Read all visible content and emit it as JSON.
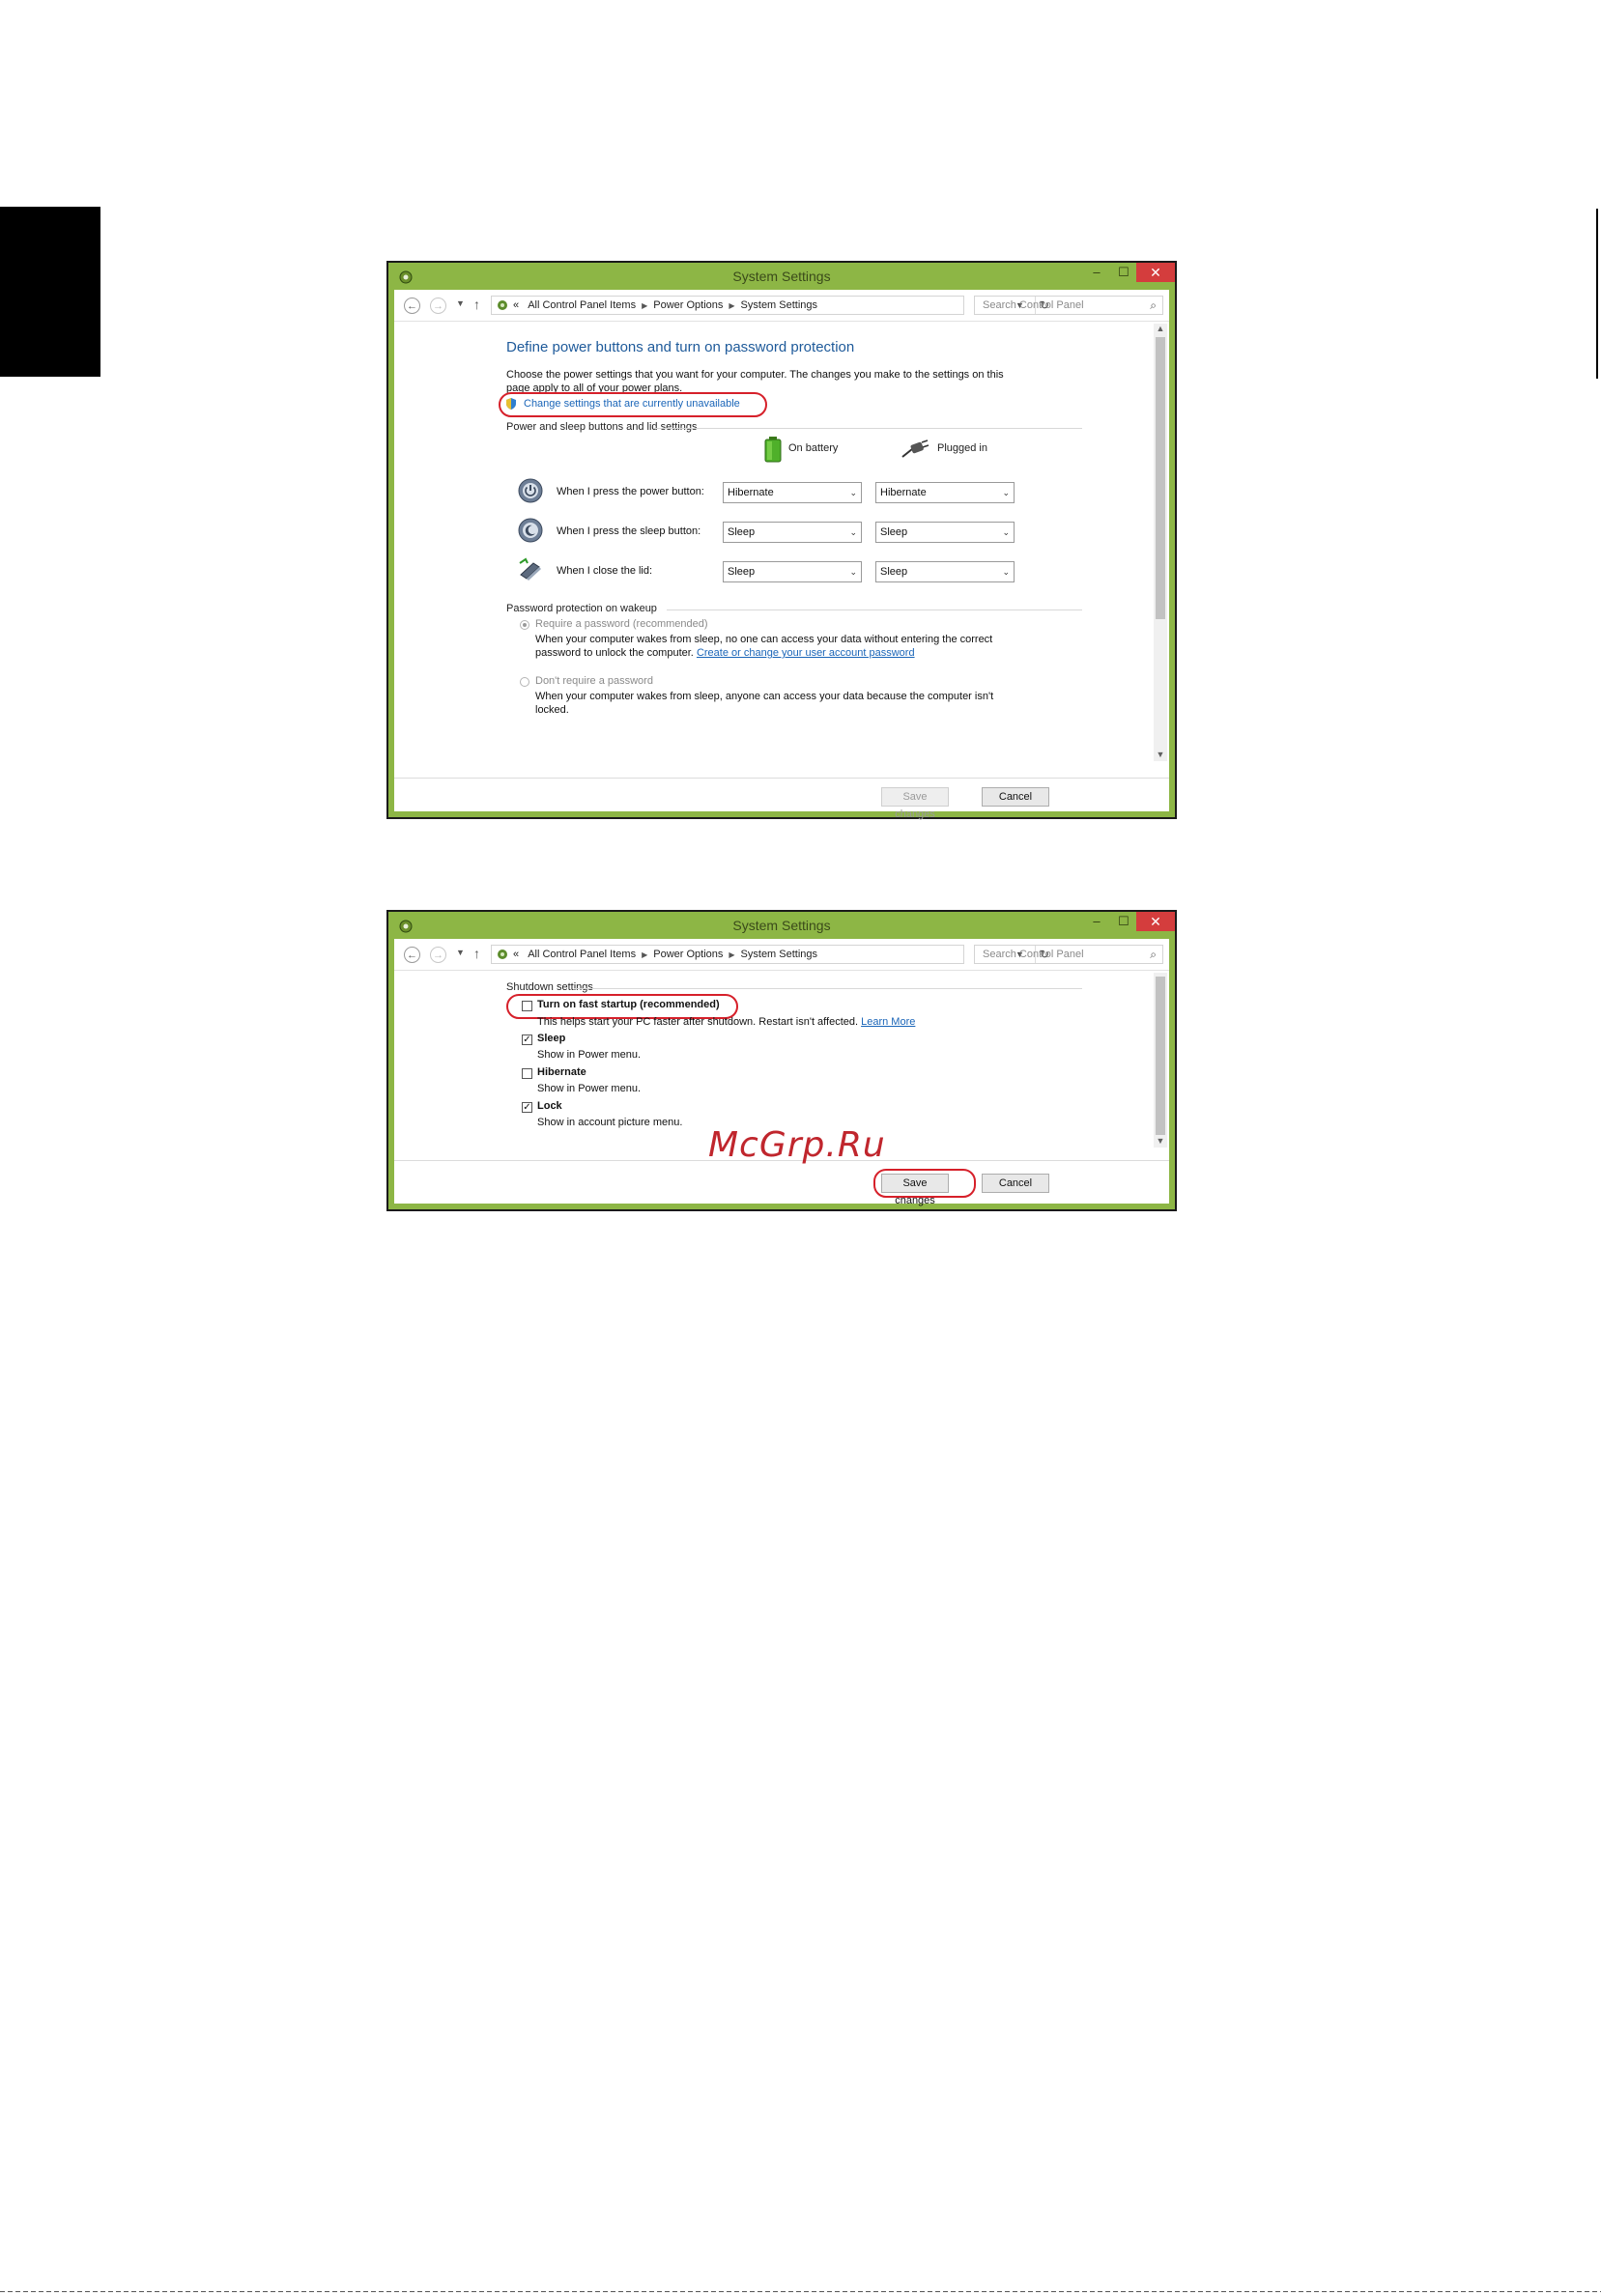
{
  "watermark": "McGrp.Ru",
  "window1": {
    "title": "System Settings",
    "controls": {
      "minimize": "–",
      "maximize": "☐",
      "close": "✕"
    },
    "breadcrumb": {
      "prefix": "«",
      "items": [
        "All Control Panel Items",
        "Power Options",
        "System Settings"
      ]
    },
    "search_placeholder": "Search Control Panel",
    "heading": "Define power buttons and turn on password protection",
    "description_line1": "Choose the power settings that you want for your computer. The changes you make to the settings on this",
    "description_line2": "page apply to all of your power plans.",
    "change_settings_link": "Change settings that are currently unavailable",
    "buttons_section_title": "Power and sleep buttons and lid settings",
    "columns": {
      "battery": "On battery",
      "plugged": "Plugged in"
    },
    "rows": [
      {
        "label": "When I press the power button:",
        "battery": "Hibernate",
        "plugged": "Hibernate"
      },
      {
        "label": "When I press the sleep button:",
        "battery": "Sleep",
        "plugged": "Sleep"
      },
      {
        "label": "When I close the lid:",
        "battery": "Sleep",
        "plugged": "Sleep"
      }
    ],
    "password_section_title": "Password protection on wakeup",
    "require_password": {
      "label": "Require a password (recommended)",
      "desc_line1": "When your computer wakes from sleep, no one can access your data without entering the correct",
      "desc_line2": "password to unlock the computer.",
      "link": "Create or change your user account password",
      "selected": true
    },
    "no_password": {
      "label": "Don't require a password",
      "desc_line1": "When your computer wakes from sleep, anyone can access your data because the computer isn't",
      "desc_line2": "locked.",
      "selected": false
    },
    "save_label": "Save changes",
    "cancel_label": "Cancel"
  },
  "window2": {
    "title": "System Settings",
    "controls": {
      "minimize": "–",
      "maximize": "☐",
      "close": "✕"
    },
    "breadcrumb": {
      "prefix": "«",
      "items": [
        "All Control Panel Items",
        "Power Options",
        "System Settings"
      ]
    },
    "search_placeholder": "Search Control Panel",
    "shutdown_section_title": "Shutdown settings",
    "options": [
      {
        "label": "Turn on fast startup (recommended)",
        "desc": "This helps start your PC faster after shutdown. Restart isn't affected.",
        "link": "Learn More",
        "checked": false
      },
      {
        "label": "Sleep",
        "desc": "Show in Power menu.",
        "checked": true
      },
      {
        "label": "Hibernate",
        "desc": "Show in Power menu.",
        "checked": false
      },
      {
        "label": "Lock",
        "desc": "Show in account picture menu.",
        "checked": true
      }
    ],
    "save_label": "Save changes",
    "cancel_label": "Cancel"
  }
}
